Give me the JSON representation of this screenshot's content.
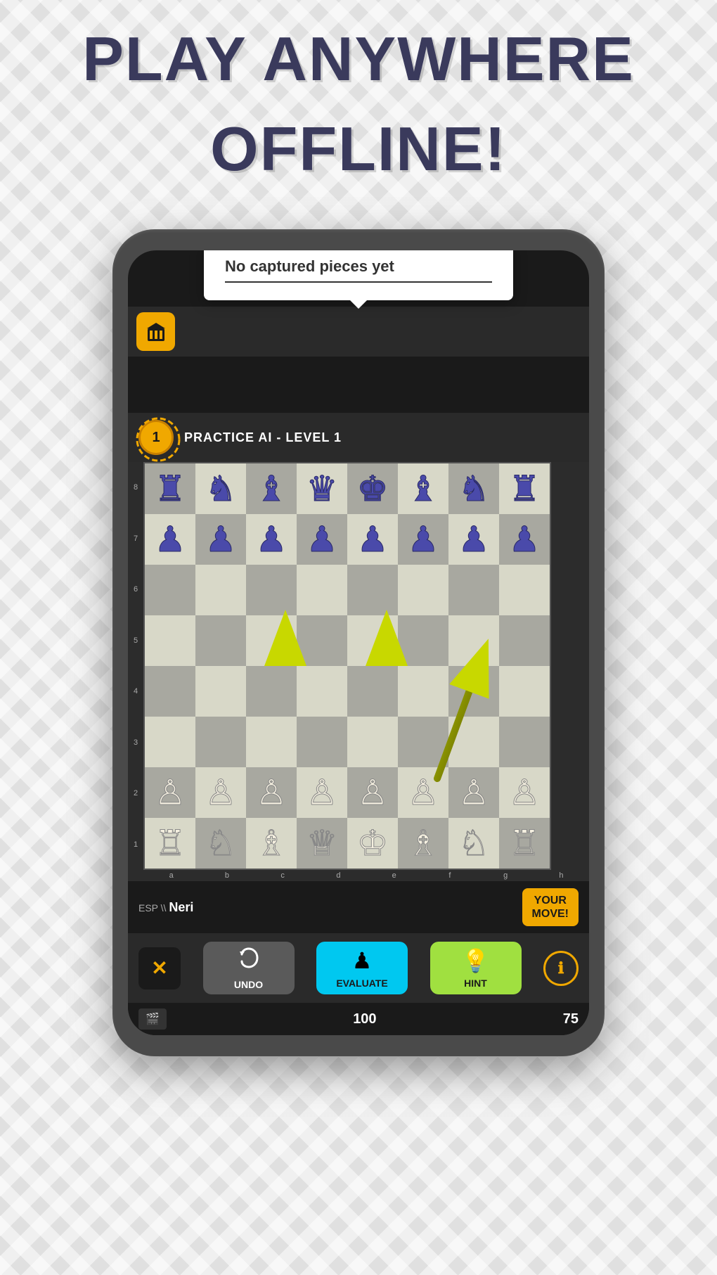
{
  "title_line1": "PLAY ANYWHERE",
  "title_line2": "OFFLINE!",
  "tooltip": {
    "text": "No captured pieces yet",
    "underline": true
  },
  "game_header": {
    "level_number": "1",
    "level_title": "PRACTICE AI - LEVEL 1"
  },
  "board": {
    "rows": [
      "8",
      "7",
      "6",
      "5",
      "4",
      "3",
      "2",
      "1"
    ],
    "cols": [
      "a",
      "b",
      "c",
      "d",
      "e",
      "f",
      "g",
      "h"
    ]
  },
  "player": {
    "flag_code": "ESP",
    "name": "Neri",
    "your_move_label": "YOUR\nMOVE!"
  },
  "buttons": {
    "close_label": "✕",
    "undo_label": "UNDO",
    "evaluate_label": "EVALUATE",
    "hint_label": "HINT",
    "info_label": "ℹ"
  },
  "scores": {
    "film_icon": "🎬",
    "score1": "100",
    "score2": "75"
  },
  "arrows": [
    {
      "fromCol": 2,
      "fromRow": 6,
      "toCol": 2,
      "toRow": 2,
      "type": "up"
    },
    {
      "fromCol": 4,
      "fromRow": 6,
      "toCol": 4,
      "toRow": 2,
      "type": "up"
    },
    {
      "fromCol": 5,
      "fromRow": 6,
      "toCol": 6,
      "toRow": 2,
      "type": "diagonal"
    }
  ]
}
